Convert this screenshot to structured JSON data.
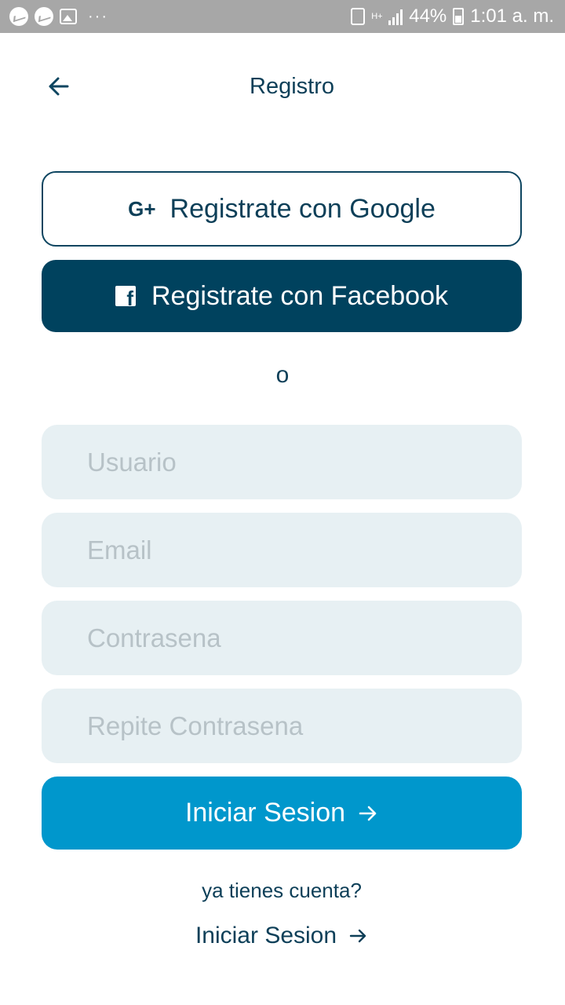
{
  "status_bar": {
    "dots": "···",
    "network": "H+",
    "battery": "44%",
    "time": "1:01 a. m."
  },
  "header": {
    "title": "Registro",
    "back_icon": "arrow-left-icon"
  },
  "social": {
    "google_icon_text": "G+",
    "google_label": "Registrate con Google",
    "facebook_icon_text": "f",
    "facebook_label": "Registrate con Facebook"
  },
  "separator": "o",
  "form": {
    "username_placeholder": "Usuario",
    "email_placeholder": "Email",
    "password_placeholder": "Contrasena",
    "repeat_password_placeholder": "Repite Contrasena",
    "submit_label": "Iniciar Sesion"
  },
  "footer": {
    "question": "ya tienes cuenta?",
    "login_label": "Iniciar Sesion"
  },
  "colors": {
    "primary_dark": "#00425e",
    "primary_blue": "#0097cc",
    "input_bg": "#e7f0f3",
    "status_bar": "#a7a7a7"
  }
}
